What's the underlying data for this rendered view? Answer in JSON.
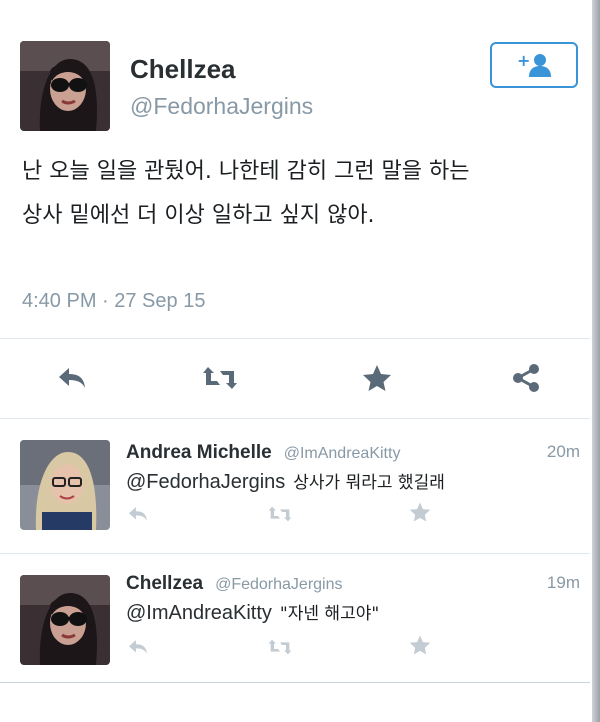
{
  "tweet": {
    "author_name": "Chellzea",
    "author_handle": "@FedorhaJergins",
    "text_line1": "난 오늘 일을 관뒀어. 나한테 감히 그런 말을 하는",
    "text_line2": "상사 밑에선 더 이상 일하고 싶지 않아.",
    "timestamp": "4:40 PM · 27 Sep 15",
    "follow_icon": "add-user-icon",
    "actions": [
      "reply-icon",
      "retweet-icon",
      "favorite-icon",
      "share-icon"
    ]
  },
  "replies": [
    {
      "name": "Andrea Michelle",
      "handle": "@ImAndreaKitty",
      "time": "20m",
      "mention": "@FedorhaJergins",
      "text": "상사가 뭐라고 했길래"
    },
    {
      "name": "Chellzea",
      "handle": "@FedorhaJergins",
      "time": "19m",
      "mention": "@ImAndreaKitty",
      "text": "\"자넨 해고야\""
    }
  ],
  "colors": {
    "accent": "#3a94d8",
    "muted": "#8899a6",
    "text": "#292f33",
    "icon": "#5b6a78"
  }
}
